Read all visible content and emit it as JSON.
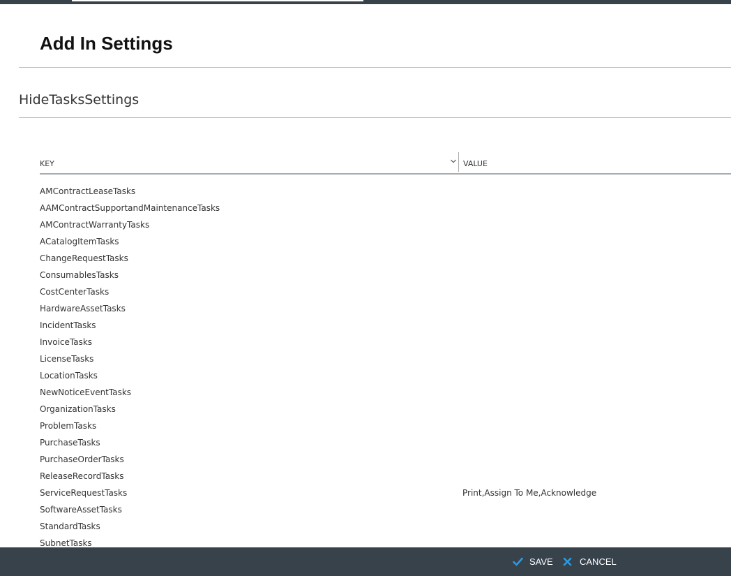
{
  "header": {
    "title": "Add In Settings"
  },
  "section": {
    "title": "HideTasksSettings"
  },
  "grid": {
    "columns": {
      "key": "KEY",
      "value": "VALUE"
    },
    "rows": [
      {
        "key": "AMContractLeaseTasks",
        "value": ""
      },
      {
        "key": "AAMContractSupportandMaintenanceTasks",
        "value": ""
      },
      {
        "key": "AMContractWarrantyTasks",
        "value": ""
      },
      {
        "key": "ACatalogItemTasks",
        "value": ""
      },
      {
        "key": "ChangeRequestTasks",
        "value": ""
      },
      {
        "key": "ConsumablesTasks",
        "value": ""
      },
      {
        "key": "CostCenterTasks",
        "value": ""
      },
      {
        "key": "HardwareAssetTasks",
        "value": ""
      },
      {
        "key": "IncidentTasks",
        "value": ""
      },
      {
        "key": "InvoiceTasks",
        "value": ""
      },
      {
        "key": "LicenseTasks",
        "value": ""
      },
      {
        "key": "LocationTasks",
        "value": ""
      },
      {
        "key": "NewNoticeEventTasks",
        "value": ""
      },
      {
        "key": "OrganizationTasks",
        "value": ""
      },
      {
        "key": "ProblemTasks",
        "value": ""
      },
      {
        "key": "PurchaseTasks",
        "value": ""
      },
      {
        "key": "PurchaseOrderTasks",
        "value": ""
      },
      {
        "key": "ReleaseRecordTasks",
        "value": ""
      },
      {
        "key": "ServiceRequestTasks",
        "value": "Print,Assign To Me,Acknowledge"
      },
      {
        "key": "SoftwareAssetTasks",
        "value": ""
      },
      {
        "key": "StandardTasks",
        "value": ""
      },
      {
        "key": "SubnetTasks",
        "value": ""
      }
    ]
  },
  "footer": {
    "save_label": "SAVE",
    "cancel_label": "CANCEL",
    "save_icon": "check-icon",
    "cancel_icon": "close-icon",
    "icon_color": "#2b9be6",
    "bar_color": "#37424b"
  }
}
